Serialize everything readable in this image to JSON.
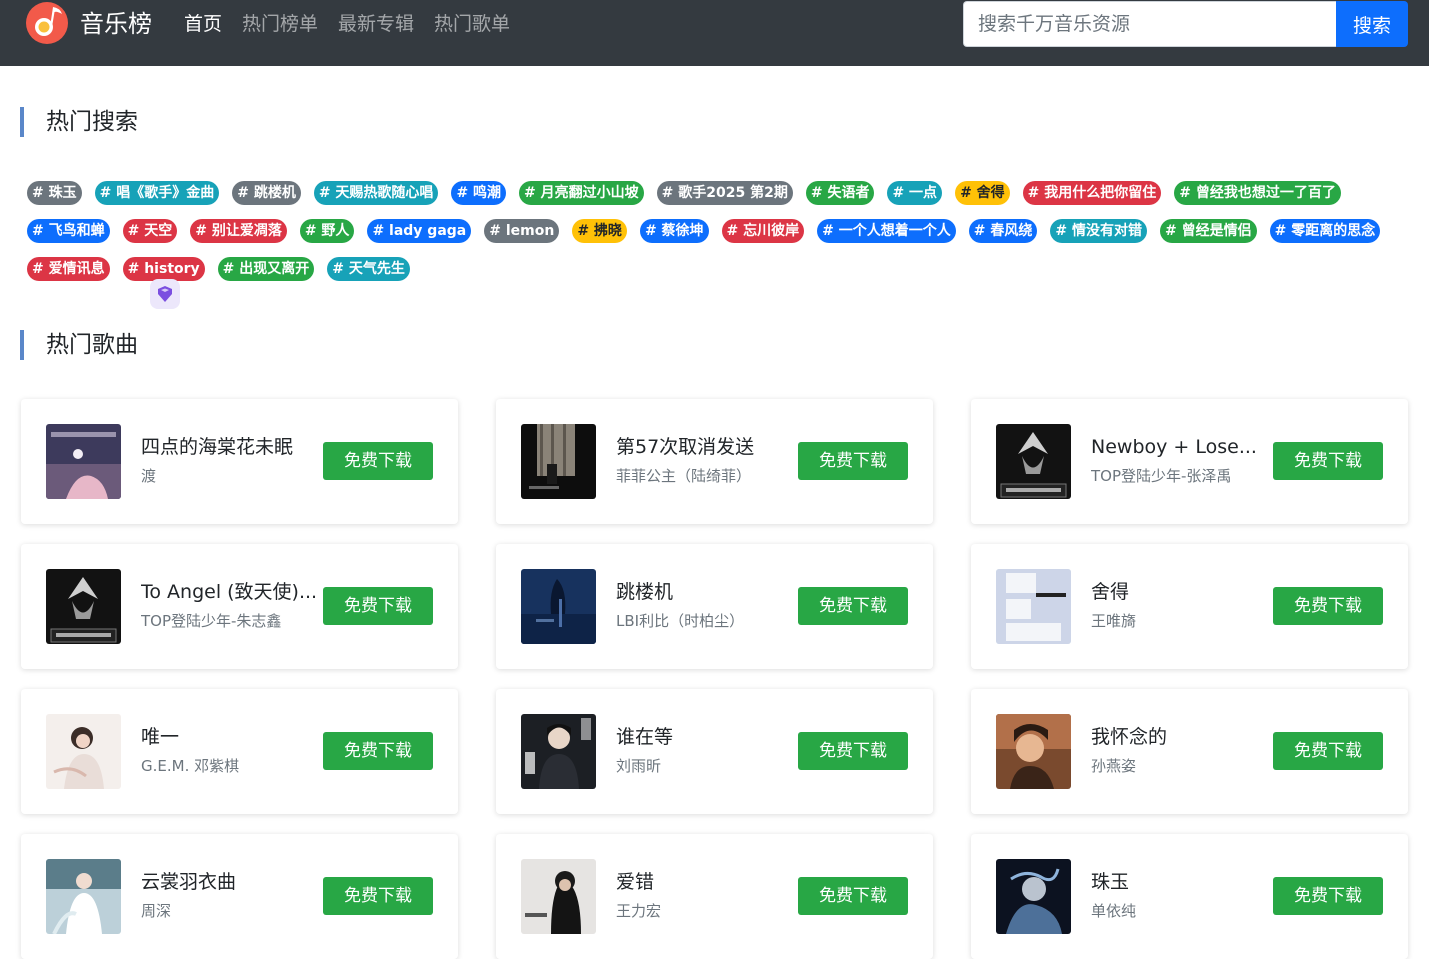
{
  "header": {
    "brand": "音乐榜",
    "nav": [
      {
        "label": "首页",
        "active": true
      },
      {
        "label": "热门榜单",
        "active": false
      },
      {
        "label": "最新专辑",
        "active": false
      },
      {
        "label": "热门歌单",
        "active": false
      }
    ],
    "search": {
      "placeholder": "搜索千万音乐资源",
      "value": "",
      "button_label": "搜索"
    }
  },
  "hot_search": {
    "title": "热门搜索",
    "rows": [
      [
        {
          "label": "# 珠玉",
          "color": "#6c757d"
        },
        {
          "label": "# 唱《歌手》金曲",
          "color": "#17a2b8"
        },
        {
          "label": "# 跳楼机",
          "color": "#6c757d"
        },
        {
          "label": "# 天赐热歌随心唱",
          "color": "#17a2b8"
        },
        {
          "label": "# 鸣潮",
          "color": "#0d6efd"
        },
        {
          "label": "# 月亮翻过小山坡",
          "color": "#28a745"
        },
        {
          "label": "# 歌手2025 第2期",
          "color": "#6c757d"
        },
        {
          "label": "# 失语者",
          "color": "#28a745"
        },
        {
          "label": "# 一点",
          "color": "#17a2b8"
        },
        {
          "label": "# 舍得",
          "color": "#ffc107",
          "dark": true
        },
        {
          "label": "# 我用什么把你留住",
          "color": "#dc3545"
        },
        {
          "label": "# 曾经我也想过一了百了",
          "color": "#28a745"
        }
      ],
      [
        {
          "label": "# 飞鸟和蝉",
          "color": "#0d6efd"
        },
        {
          "label": "# 天空",
          "color": "#dc3545"
        },
        {
          "label": "# 别让爱凋落",
          "color": "#dc3545"
        },
        {
          "label": "# 野人",
          "color": "#28a745"
        },
        {
          "label": "# lady gaga",
          "color": "#0d6efd"
        },
        {
          "label": "# lemon",
          "color": "#6c757d"
        },
        {
          "label": "# 拂晓",
          "color": "#ffc107",
          "dark": true
        },
        {
          "label": "# 蔡徐坤",
          "color": "#0d6efd"
        },
        {
          "label": "# 忘川彼岸",
          "color": "#dc3545"
        },
        {
          "label": "# 一个人想着一个人",
          "color": "#0d6efd"
        },
        {
          "label": "# 春风绕",
          "color": "#0d6efd"
        },
        {
          "label": "# 情没有对错",
          "color": "#17a2b8"
        },
        {
          "label": "# 曾经是情侣",
          "color": "#28a745"
        },
        {
          "label": "# 零距离的思念",
          "color": "#0d6efd"
        }
      ],
      [
        {
          "label": "# 爱情讯息",
          "color": "#dc3545"
        },
        {
          "label": "# history",
          "color": "#dc3545"
        },
        {
          "label": "# 出现又离开",
          "color": "#28a745"
        },
        {
          "label": "# 天气先生",
          "color": "#17a2b8"
        }
      ]
    ]
  },
  "hot_songs": {
    "title": "热门歌曲",
    "download_label": "免费下载",
    "songs": [
      {
        "title": "四点的海棠花未眠",
        "artist": "渡",
        "cover": "haitang-cover"
      },
      {
        "title": "第57次取消发送",
        "artist": "菲菲公主（陆绮菲）",
        "cover": "window-cover"
      },
      {
        "title": "Newboy + Lose...",
        "artist": "TOP登陆少年-张泽禹",
        "cover": "top-cover"
      },
      {
        "title": "To Angel (致天使)...",
        "artist": "TOP登陆少年-朱志鑫",
        "cover": "top-cover"
      },
      {
        "title": "跳楼机",
        "artist": "LBI利比（时柏尘）",
        "cover": "blue-cover"
      },
      {
        "title": "舍得",
        "artist": "王唯旖",
        "cover": "number-cover"
      },
      {
        "title": "唯一",
        "artist": "G.E.M. 邓紫棋",
        "cover": "gem-cover"
      },
      {
        "title": "谁在等",
        "artist": "刘雨昕",
        "cover": "portrait-dark-cover"
      },
      {
        "title": "我怀念的",
        "artist": "孙燕姿",
        "cover": "sun-cover"
      },
      {
        "title": "云裳羽衣曲",
        "artist": "周深",
        "cover": "costume-cover"
      },
      {
        "title": "爱错",
        "artist": "王力宏",
        "cover": "wang-cover"
      },
      {
        "title": "珠玉",
        "artist": "单依纯",
        "cover": "ink-cover"
      }
    ]
  }
}
